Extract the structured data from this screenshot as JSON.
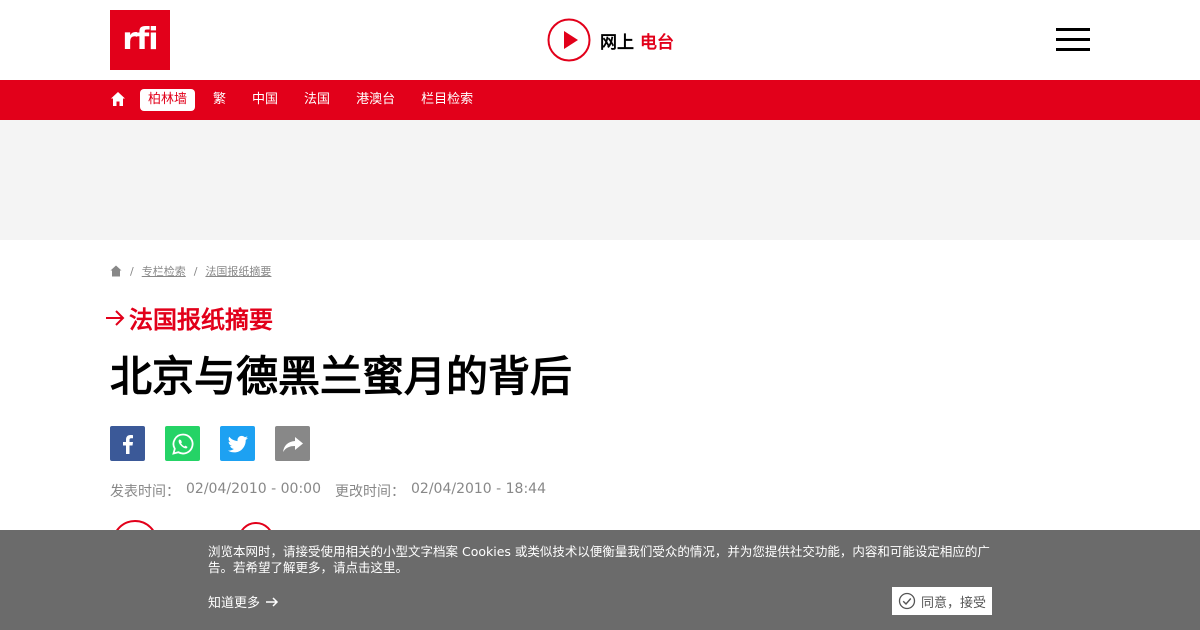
{
  "header": {
    "logo_text": "rfi",
    "radio_label_1": "网上",
    "radio_label_2": "电台"
  },
  "nav": {
    "items": [
      {
        "label": "柏林墙",
        "active": true
      },
      {
        "label": "繁"
      },
      {
        "label": "中国"
      },
      {
        "label": "法国"
      },
      {
        "label": "港澳台"
      },
      {
        "label": "栏目检索"
      }
    ]
  },
  "breadcrumb": {
    "items": [
      "专栏检索",
      "法国报纸摘要"
    ],
    "separator": "/"
  },
  "article": {
    "section": "法国报纸摘要",
    "title": "北京与德黑兰蜜月的背后",
    "published_label": "发表时间：",
    "published": "02/04/2010 - 00:00",
    "updated_label": "更改时间：",
    "updated": "02/04/2010 - 18:44"
  },
  "share": {
    "icons": [
      "facebook-icon",
      "whatsapp-icon",
      "twitter-icon",
      "share-icon"
    ]
  },
  "cookie": {
    "text": "浏览本网时，请接受使用相关的小型文字档案 Cookies 或类似技术以便衡量我们受众的情况，并为您提供社交功能，内容和可能设定相应的广告。若希望了解更多，请点击这里。",
    "more_label": "知道更多",
    "accept_label": "同意，接受"
  },
  "colors": {
    "brand_red": "#e2001a",
    "facebook": "#3b5998",
    "whatsapp": "#25d366",
    "twitter": "#1da1f2"
  }
}
